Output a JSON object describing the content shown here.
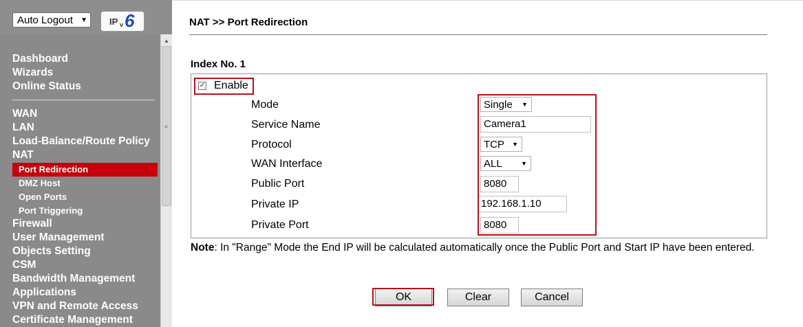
{
  "header": {
    "logout_select": "Auto Logout",
    "ipv6_logo": {
      "ip": "IP",
      "v": "v",
      "six": "6"
    }
  },
  "sidebar": {
    "group1": [
      "Dashboard",
      "Wizards",
      "Online Status"
    ],
    "items": [
      "WAN",
      "LAN",
      "Load-Balance/Route Policy",
      "NAT"
    ],
    "nat_sub": [
      "Port Redirection",
      "DMZ Host",
      "Open Ports",
      "Port Triggering"
    ],
    "active_sub": "Port Redirection",
    "more": [
      "Firewall",
      "User Management",
      "Objects Setting",
      "CSM",
      "Bandwidth Management",
      "Applications",
      "VPN and Remote Access",
      "Certificate Management"
    ]
  },
  "page": {
    "title": "NAT >> Port Redirection",
    "index_label": "Index No. 1"
  },
  "form": {
    "enable_label": "Enable",
    "enable_checked": true,
    "mode_label": "Mode",
    "mode_value": "Single",
    "service_label": "Service Name",
    "service_value": "Camera1",
    "protocol_label": "Protocol",
    "protocol_value": "TCP",
    "wan_label": "WAN Interface",
    "wan_value": "ALL",
    "public_port_label": "Public Port",
    "public_port_value": "8080",
    "private_ip_label": "Private IP",
    "private_ip_value": "192.168.1.10",
    "private_port_label": "Private Port",
    "private_port_value": "8080"
  },
  "note": {
    "bold": "Note",
    "text": ": In \"Range\" Mode the End IP will be calculated automatically once the Public Port and Start IP have been entered."
  },
  "buttons": {
    "ok": "OK",
    "clear": "Clear",
    "cancel": "Cancel"
  },
  "colors": {
    "sidebar_bg": "#8a8a8a",
    "active_bg": "#c8000a",
    "highlight": "#b5121b"
  }
}
